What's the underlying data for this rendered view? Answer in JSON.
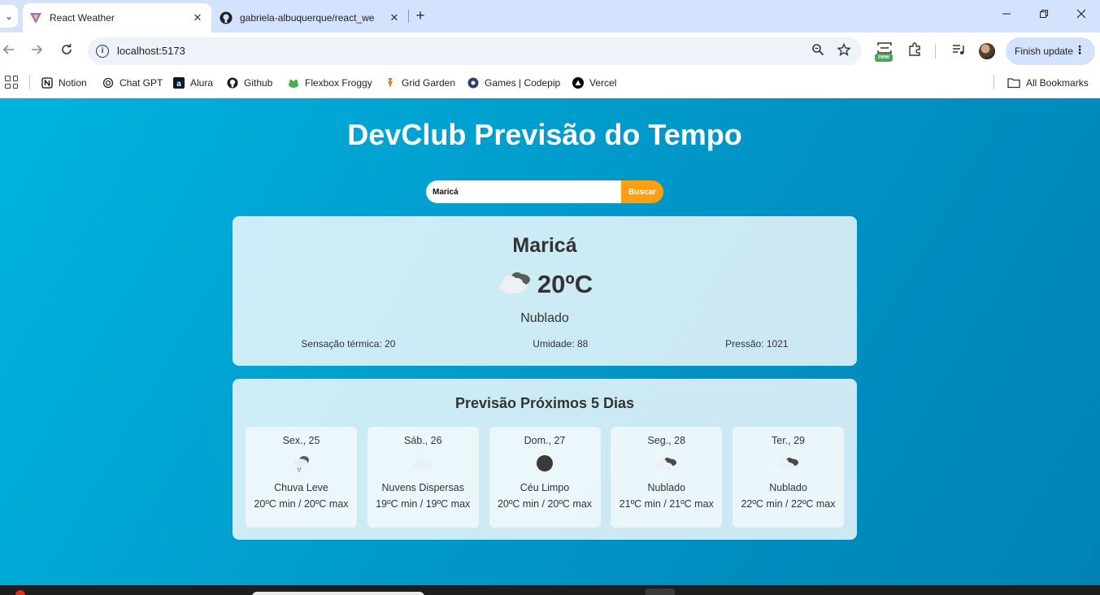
{
  "browser": {
    "tabs": [
      {
        "title": "React Weather",
        "icon": "vite-icon"
      },
      {
        "title": "gabriela-albuquerque/react_we",
        "icon": "github-icon"
      }
    ],
    "tab_dropdown": "⌄",
    "close_glyph": "✕",
    "new_tab_glyph": "+",
    "address": "localhost:5173",
    "finish_update": "Finish update",
    "new_badge": "new",
    "bookmarks": [
      {
        "label": "Notion",
        "icon": "notion-icon"
      },
      {
        "label": "Chat GPT",
        "icon": "chatgpt-icon"
      },
      {
        "label": "Alura",
        "icon": "alura-icon"
      },
      {
        "label": "Github",
        "icon": "github-icon"
      },
      {
        "label": "Flexbox Froggy",
        "icon": "frog-icon"
      },
      {
        "label": "Grid Garden",
        "icon": "carrot-icon"
      },
      {
        "label": "Games | Codepip",
        "icon": "codepip-icon"
      },
      {
        "label": "Vercel",
        "icon": "vercel-icon"
      }
    ],
    "all_bookmarks": "All Bookmarks"
  },
  "app": {
    "title": "DevClub Previsão do Tempo",
    "search": {
      "value": "Maricá",
      "button": "Buscar"
    },
    "current": {
      "city": "Maricá",
      "temperature": "20ºC",
      "description": "Nublado",
      "icon": "broken-clouds-icon",
      "feels_like": "Sensação térmica: 20",
      "humidity": "Umidade: 88",
      "pressure": "Pressão: 1021"
    },
    "forecast": {
      "title": "Previsão Próximos 5 Dias",
      "days": [
        {
          "date": "Sex., 25",
          "icon": "light-rain-icon",
          "description": "Chuva Leve",
          "temps": "20ºC min / 20ºC max"
        },
        {
          "date": "Sáb., 26",
          "icon": "scattered-clouds-icon",
          "description": "Nuvens Dispersas",
          "temps": "19ºC min / 19ºC max"
        },
        {
          "date": "Dom., 27",
          "icon": "clear-sky-night-icon",
          "description": "Céu Limpo",
          "temps": "20ºC min / 20ºC max"
        },
        {
          "date": "Seg., 28",
          "icon": "broken-clouds-icon",
          "description": "Nublado",
          "temps": "21ºC min / 21ºC max"
        },
        {
          "date": "Ter., 29",
          "icon": "broken-clouds-icon",
          "description": "Nublado",
          "temps": "22ºC min / 22ºC max"
        }
      ]
    }
  },
  "colors": {
    "background_start": "#00b4df",
    "background_end": "#0082b4",
    "search_button": "#ff9f0d",
    "card": "rgba(255,255,255,0.8)",
    "tabbar": "#d3e3fd"
  }
}
